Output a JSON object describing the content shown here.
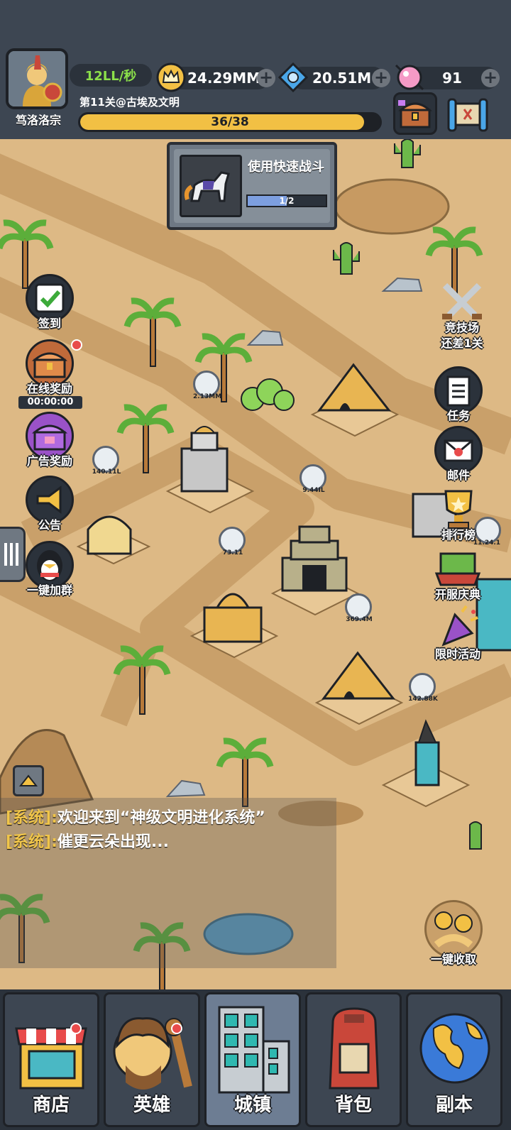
{
  "player": {
    "name": "笃洛洛宗",
    "income_rate": "12LL/秒"
  },
  "resources": {
    "crown": "24.29MM",
    "gem": "20.51M",
    "candy": "91"
  },
  "level": {
    "label": "第11关@古埃及文明",
    "progress_text": "36/38",
    "progress": 0.947
  },
  "task": {
    "title": "使用快速战斗",
    "progress_text": "1/2",
    "progress": 0.5
  },
  "left_buttons": {
    "sign_in": "签到",
    "online_reward": "在线奖励",
    "timer": "00:00:00",
    "ad_reward": "广告奖励",
    "notice": "公告",
    "join_group": "一键加群"
  },
  "right_buttons": {
    "arena": "竞技场",
    "arena_sub": "还差1关",
    "quest": "任务",
    "mail": "邮件",
    "ranking": "排行榜",
    "celebration": "开服庆典",
    "limited_event": "限时活动",
    "collect_all": "一键收取"
  },
  "buildings": {
    "b1": "2.13MM",
    "b2": "140.11L",
    "b3": "9.44IL",
    "b4": "73.11",
    "b5": "369.4M",
    "b6": "142.88K",
    "b7": "11.24.1"
  },
  "chat": [
    {
      "tag": "[系统]:",
      "text": "欢迎来到“神级文明进化系统”"
    },
    {
      "tag": "[系统]:",
      "text": "催更云朵出现..."
    }
  ],
  "nav": {
    "shop": "商店",
    "heroes": "英雄",
    "town": "城镇",
    "bag": "背包",
    "dungeon": "副本"
  },
  "colors": {
    "topbar": "#3d4652",
    "sand": "#ddb985",
    "road": "#c9a06a",
    "accent_gold": "#f2c044",
    "income_green": "#8ce04a",
    "chat_tag": "#f0c54a"
  }
}
